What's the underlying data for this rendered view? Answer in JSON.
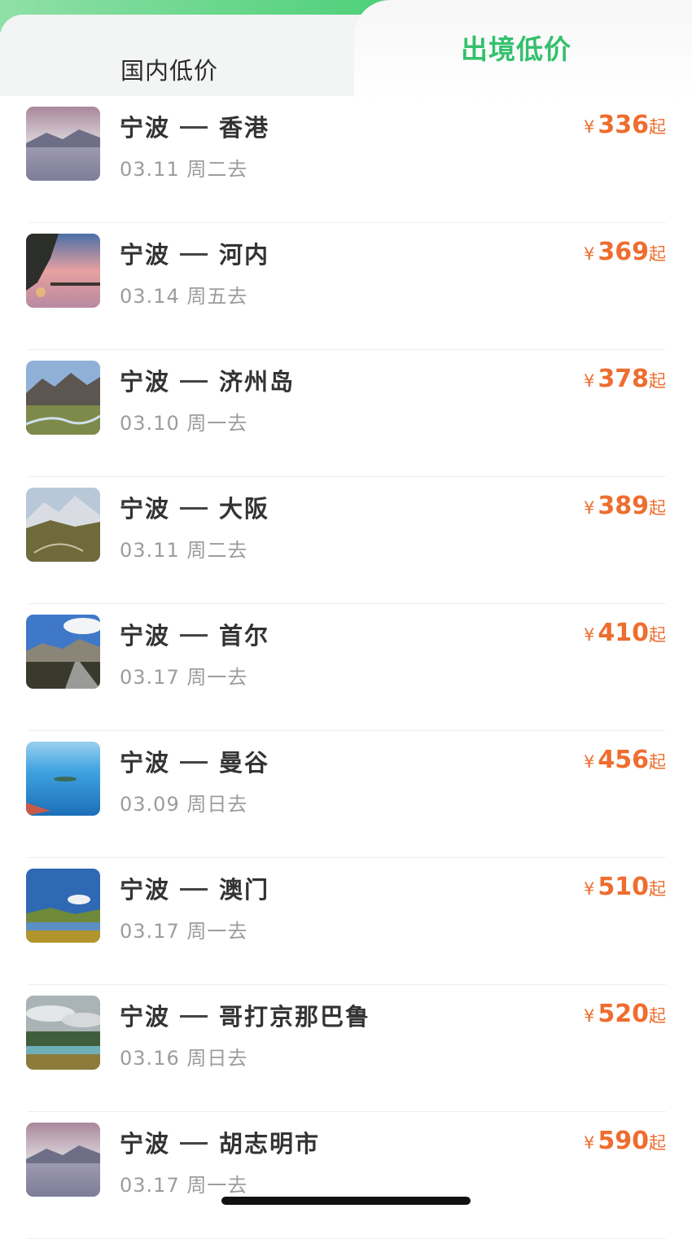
{
  "tabs": {
    "domestic": "国内低价",
    "international": "出境低价"
  },
  "colors": {
    "accent_green": "#34c06c",
    "price_orange": "#ee6d2f"
  },
  "currency_symbol": "¥",
  "price_suffix": "起",
  "flights": [
    {
      "from": "宁波",
      "to": "香港",
      "date": "03.11 周二去",
      "price": "336",
      "scene": "lake-mountains"
    },
    {
      "from": "宁波",
      "to": "河内",
      "date": "03.14 周五去",
      "price": "369",
      "scene": "palm-sunset-pier"
    },
    {
      "from": "宁波",
      "to": "济州岛",
      "date": "03.10 周一去",
      "price": "378",
      "scene": "mountain-river-valley"
    },
    {
      "from": "宁波",
      "to": "大阪",
      "date": "03.11 周二去",
      "price": "389",
      "scene": "snowy-mountain-road"
    },
    {
      "from": "宁波",
      "to": "首尔",
      "date": "03.17 周一去",
      "price": "410",
      "scene": "mountain-highway"
    },
    {
      "from": "宁波",
      "to": "曼谷",
      "date": "03.09 周日去",
      "price": "456",
      "scene": "blue-sea-islands"
    },
    {
      "from": "宁波",
      "to": "澳门",
      "date": "03.17 周一去",
      "price": "510",
      "scene": "lake-blue-sky"
    },
    {
      "from": "宁波",
      "to": "哥打京那巴鲁",
      "date": "03.16 周日去",
      "price": "520",
      "scene": "misty-forest-lake"
    },
    {
      "from": "宁波",
      "to": "胡志明市",
      "date": "03.17 周一去",
      "price": "590",
      "scene": "lake-mountains"
    }
  ]
}
